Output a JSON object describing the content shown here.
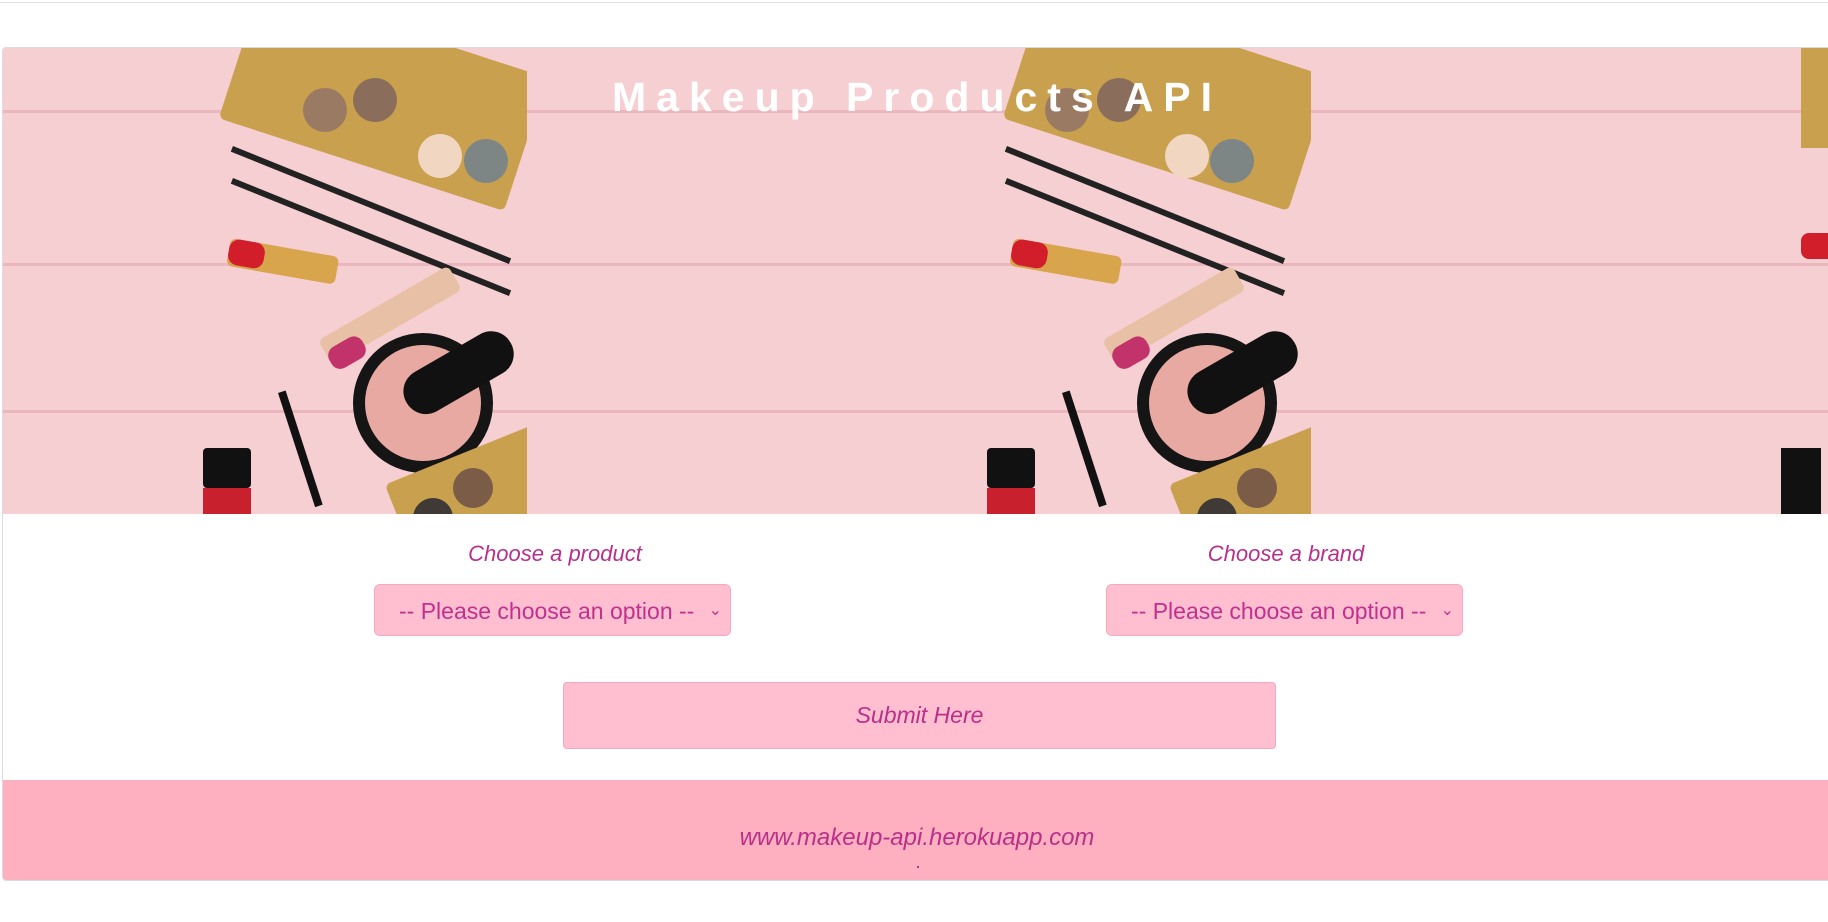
{
  "header": {
    "title": "Makeup Products API"
  },
  "form": {
    "product_label": "Choose a product",
    "brand_label": "Choose a brand",
    "product_select_value": "-- Please choose an option --",
    "brand_select_value": "-- Please choose an option --",
    "submit_label": "Submit Here"
  },
  "footer": {
    "link": "www.makeup-api.herokuapp.com"
  },
  "colors": {
    "accent_text": "#b8308a",
    "input_bg": "#ffbfd0",
    "footer_bg": "#ffb0c0",
    "hero_bg": "#f6cfd3"
  },
  "icons": [
    "chevron-down-icon"
  ]
}
